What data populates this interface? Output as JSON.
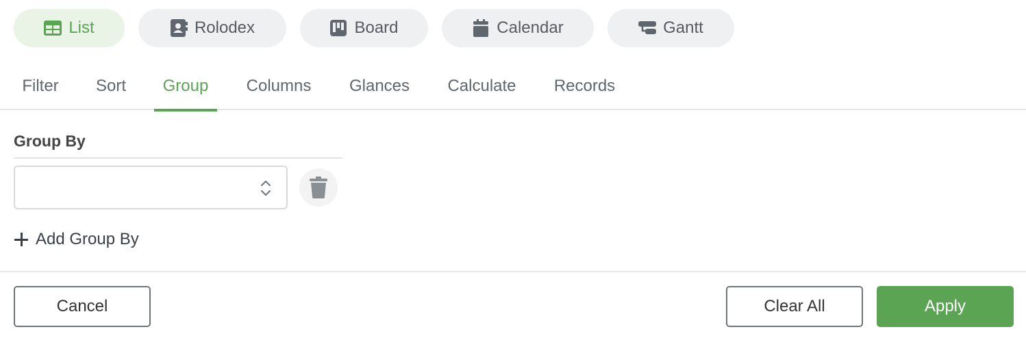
{
  "views": [
    {
      "label": "List",
      "icon": "table-icon",
      "active": true
    },
    {
      "label": "Rolodex",
      "icon": "contact-card-icon",
      "active": false
    },
    {
      "label": "Board",
      "icon": "kanban-icon",
      "active": false
    },
    {
      "label": "Calendar",
      "icon": "calendar-icon",
      "active": false
    },
    {
      "label": "Gantt",
      "icon": "gantt-icon",
      "active": false
    }
  ],
  "tabs": [
    {
      "label": "Filter",
      "active": false
    },
    {
      "label": "Sort",
      "active": false
    },
    {
      "label": "Group",
      "active": true
    },
    {
      "label": "Columns",
      "active": false
    },
    {
      "label": "Glances",
      "active": false
    },
    {
      "label": "Calculate",
      "active": false
    },
    {
      "label": "Records",
      "active": false
    }
  ],
  "group": {
    "title": "Group By",
    "select_value": "",
    "add_label": "Add Group By"
  },
  "footer": {
    "cancel_label": "Cancel",
    "clear_label": "Clear All",
    "apply_label": "Apply"
  },
  "colors": {
    "accent": "#5aa454",
    "accent_bg": "#e9f4e6",
    "pill_bg": "#eff0f1",
    "icon_gray": "#5f666d"
  }
}
